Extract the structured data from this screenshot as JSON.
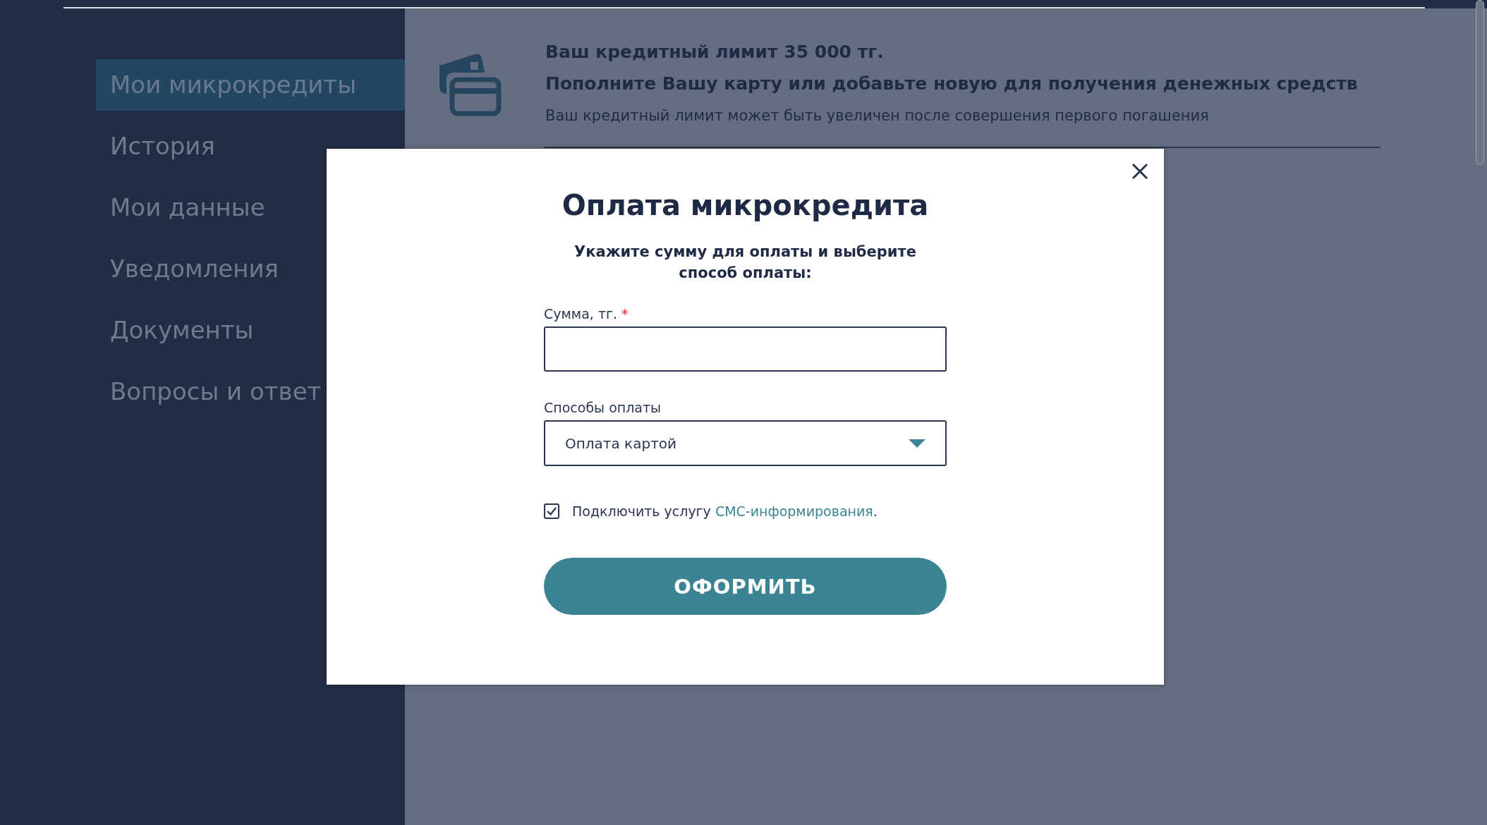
{
  "sidebar": {
    "items": [
      {
        "label": "Мои микрокредиты",
        "selected": true
      },
      {
        "label": "История",
        "selected": false
      },
      {
        "label": "Мои данные",
        "selected": false
      },
      {
        "label": "Уведомления",
        "selected": false
      },
      {
        "label": "Документы",
        "selected": false
      },
      {
        "label": "Вопросы и ответ",
        "selected": false
      }
    ]
  },
  "banner": {
    "title": "Ваш кредитный лимит 35 000 тг.",
    "subtitle": "Пополните Вашу карту или добавьте новую для получения денежных средств",
    "note": "Ваш кредитный лимит может быть увеличен после совершения первого погашения"
  },
  "modal": {
    "title": "Оплата микрокредита",
    "instruction": "Укажите сумму для оплаты и выберите способ оплаты:",
    "amount_field": {
      "label": "Сумма, тг.",
      "required_mark": "*"
    },
    "payment_method": {
      "label": "Способы оплаты",
      "value": "Оплата картой"
    },
    "sms_consent": {
      "checked": true,
      "text": "Подключить услугу ",
      "link": "СМС-информирования",
      "after": "."
    },
    "submit_button": "ОФОРМИТЬ"
  }
}
